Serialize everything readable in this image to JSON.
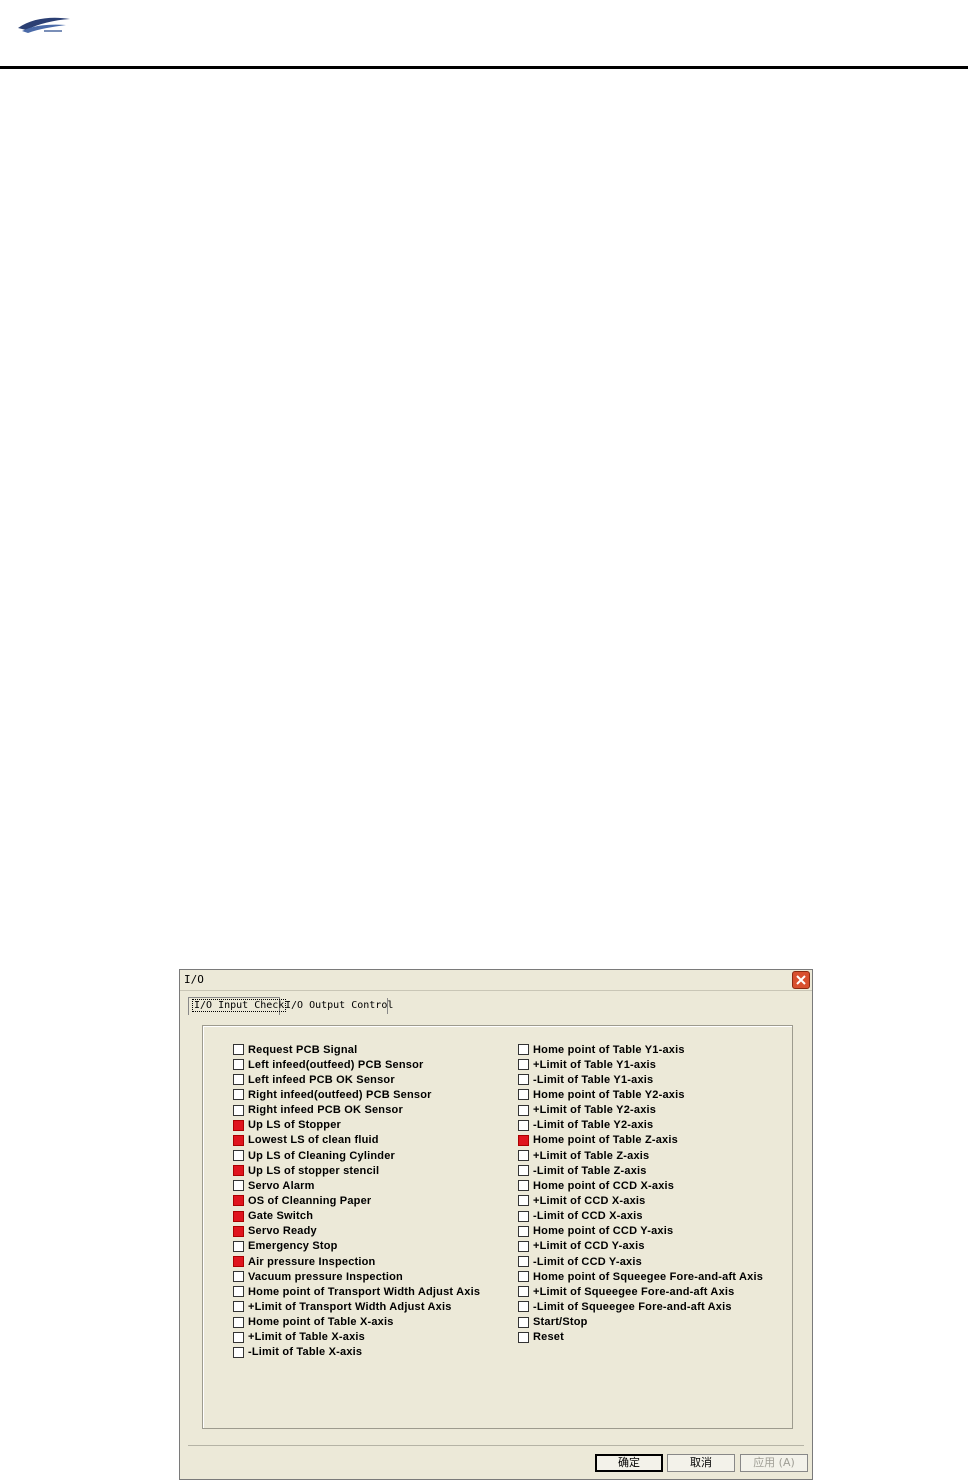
{
  "dialog": {
    "title": "I/O",
    "close_glyph": "×",
    "tabs": [
      {
        "label": "I/O Input Check",
        "active": true
      },
      {
        "label": "I/O Output Control",
        "active": false
      }
    ],
    "inputs_left": [
      {
        "label": "Request PCB Signal",
        "on": false
      },
      {
        "label": "Left infeed(outfeed) PCB Sensor",
        "on": false
      },
      {
        "label": "Left infeed PCB OK Sensor",
        "on": false
      },
      {
        "label": "Right infeed(outfeed) PCB Sensor",
        "on": false
      },
      {
        "label": "Right infeed PCB OK Sensor",
        "on": false
      },
      {
        "label": "Up LS of Stopper",
        "on": true
      },
      {
        "label": "Lowest LS of clean fluid",
        "on": true
      },
      {
        "label": "Up LS of Cleaning Cylinder",
        "on": false
      },
      {
        "label": "Up LS of stopper stencil",
        "on": true
      },
      {
        "label": "Servo Alarm",
        "on": false
      },
      {
        "label": "OS of Cleanning Paper",
        "on": true
      },
      {
        "label": "Gate Switch",
        "on": true
      },
      {
        "label": "Servo Ready",
        "on": true
      },
      {
        "label": "Emergency Stop",
        "on": false
      },
      {
        "label": "Air pressure Inspection",
        "on": true
      },
      {
        "label": "Vacuum pressure Inspection",
        "on": false
      },
      {
        "label": "Home point of  Transport Width Adjust Axis",
        "on": false
      },
      {
        "label": "+Limit of Transport Width Adjust Axis",
        "on": false
      },
      {
        "label": "Home point of Table X-axis",
        "on": false
      },
      {
        "label": "+Limit of Table X-axis",
        "on": false
      },
      {
        "label": "-Limit of Table X-axis",
        "on": false
      }
    ],
    "inputs_right": [
      {
        "label": "Home point of Table Y1-axis",
        "on": false
      },
      {
        "label": "+Limit of Table Y1-axis",
        "on": false
      },
      {
        "label": "-Limit of Table Y1-axis",
        "on": false
      },
      {
        "label": "Home point of Table Y2-axis",
        "on": false
      },
      {
        "label": "+Limit of Table Y2-axis",
        "on": false
      },
      {
        "label": "-Limit of Table Y2-axis",
        "on": false
      },
      {
        "label": "Home point of Table Z-axis",
        "on": true
      },
      {
        "label": "+Limit of Table Z-axis",
        "on": false
      },
      {
        "label": "-Limit of Table Z-axis",
        "on": false
      },
      {
        "label": "Home point of CCD X-axis",
        "on": false
      },
      {
        "label": "+Limit of CCD X-axis",
        "on": false
      },
      {
        "label": "-Limit of CCD X-axis",
        "on": false
      },
      {
        "label": "Home point of CCD Y-axis",
        "on": false
      },
      {
        "label": "+Limit of CCD Y-axis",
        "on": false
      },
      {
        "label": "-Limit of CCD Y-axis",
        "on": false
      },
      {
        "label": "Home point of Squeegee Fore-and-aft Axis",
        "on": false
      },
      {
        "label": "+Limit of Squeegee Fore-and-aft Axis",
        "on": false
      },
      {
        "label": "-Limit of Squeegee Fore-and-aft Axis",
        "on": false
      },
      {
        "label": "Start/Stop",
        "on": false
      },
      {
        "label": "Reset",
        "on": false
      }
    ],
    "buttons": {
      "ok": "确定",
      "cancel": "取消",
      "apply": "应用 (A)"
    }
  },
  "colors": {
    "active_indicator": "#e0141e",
    "dialog_bg": "#ece9d8"
  }
}
